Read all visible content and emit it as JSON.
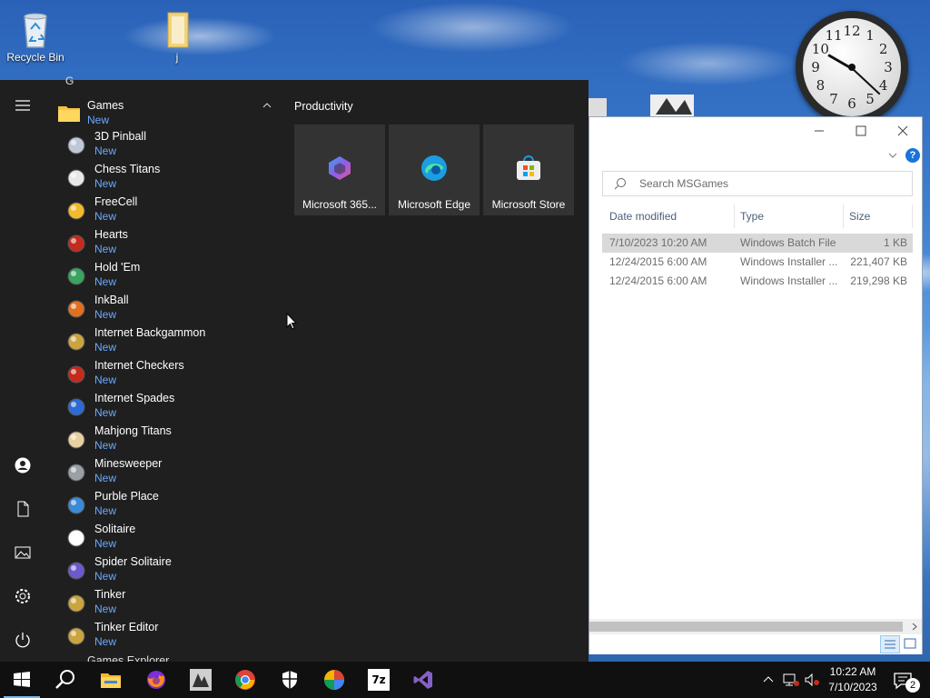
{
  "desktop": {
    "icons": [
      {
        "label": "Recycle Bin",
        "icon": "recycle-bin-icon"
      },
      {
        "label": "j",
        "icon": "folder-icon"
      }
    ],
    "clock_numbers": [
      "12",
      "1",
      "2",
      "3",
      "4",
      "5",
      "6",
      "7",
      "8",
      "9",
      "10",
      "11"
    ]
  },
  "start_menu": {
    "letter_header": "G",
    "folder": {
      "label": "Games",
      "badge": "New"
    },
    "apps": [
      {
        "name": "3D Pinball",
        "badge": "New"
      },
      {
        "name": "Chess Titans",
        "badge": "New"
      },
      {
        "name": "FreeCell",
        "badge": "New"
      },
      {
        "name": "Hearts",
        "badge": "New"
      },
      {
        "name": "Hold 'Em",
        "badge": "New"
      },
      {
        "name": "InkBall",
        "badge": "New"
      },
      {
        "name": "Internet Backgammon",
        "badge": "New"
      },
      {
        "name": "Internet Checkers",
        "badge": "New"
      },
      {
        "name": "Internet Spades",
        "badge": "New"
      },
      {
        "name": "Mahjong Titans",
        "badge": "New"
      },
      {
        "name": "Minesweeper",
        "badge": "New"
      },
      {
        "name": "Purble Place",
        "badge": "New"
      },
      {
        "name": "Solitaire",
        "badge": "New"
      },
      {
        "name": "Spider Solitaire",
        "badge": "New"
      },
      {
        "name": "Tinker",
        "badge": "New"
      },
      {
        "name": "Tinker Editor",
        "badge": "New"
      }
    ],
    "partial_item": "Games Explorer",
    "group_title": "Productivity",
    "tiles": [
      {
        "label": "Microsoft 365...",
        "icon": "microsoft-365-icon"
      },
      {
        "label": "Microsoft Edge",
        "icon": "edge-icon"
      },
      {
        "label": "Microsoft Store",
        "icon": "store-icon"
      }
    ]
  },
  "explorer": {
    "search_placeholder": "Search MSGames",
    "columns": [
      "Date modified",
      "Type",
      "Size"
    ],
    "rows": [
      {
        "date": "7/10/2023 10:20 AM",
        "type": "Windows Batch File",
        "size": "1 KB"
      },
      {
        "date": "12/24/2015 6:00 AM",
        "type": "Windows Installer ...",
        "size": "221,407 KB"
      },
      {
        "date": "12/24/2015 6:00 AM",
        "type": "Windows Installer ...",
        "size": "219,298 KB"
      }
    ]
  },
  "taskbar": {
    "time": "10:22 AM",
    "date": "7/10/2023",
    "notification_count": "2",
    "zip_label": "7z"
  },
  "colors": {
    "accent": "#6aa9ff",
    "start_bg": "#1f1f1f",
    "tile_bg": "#333333",
    "taskbar_bg": "#101010"
  }
}
